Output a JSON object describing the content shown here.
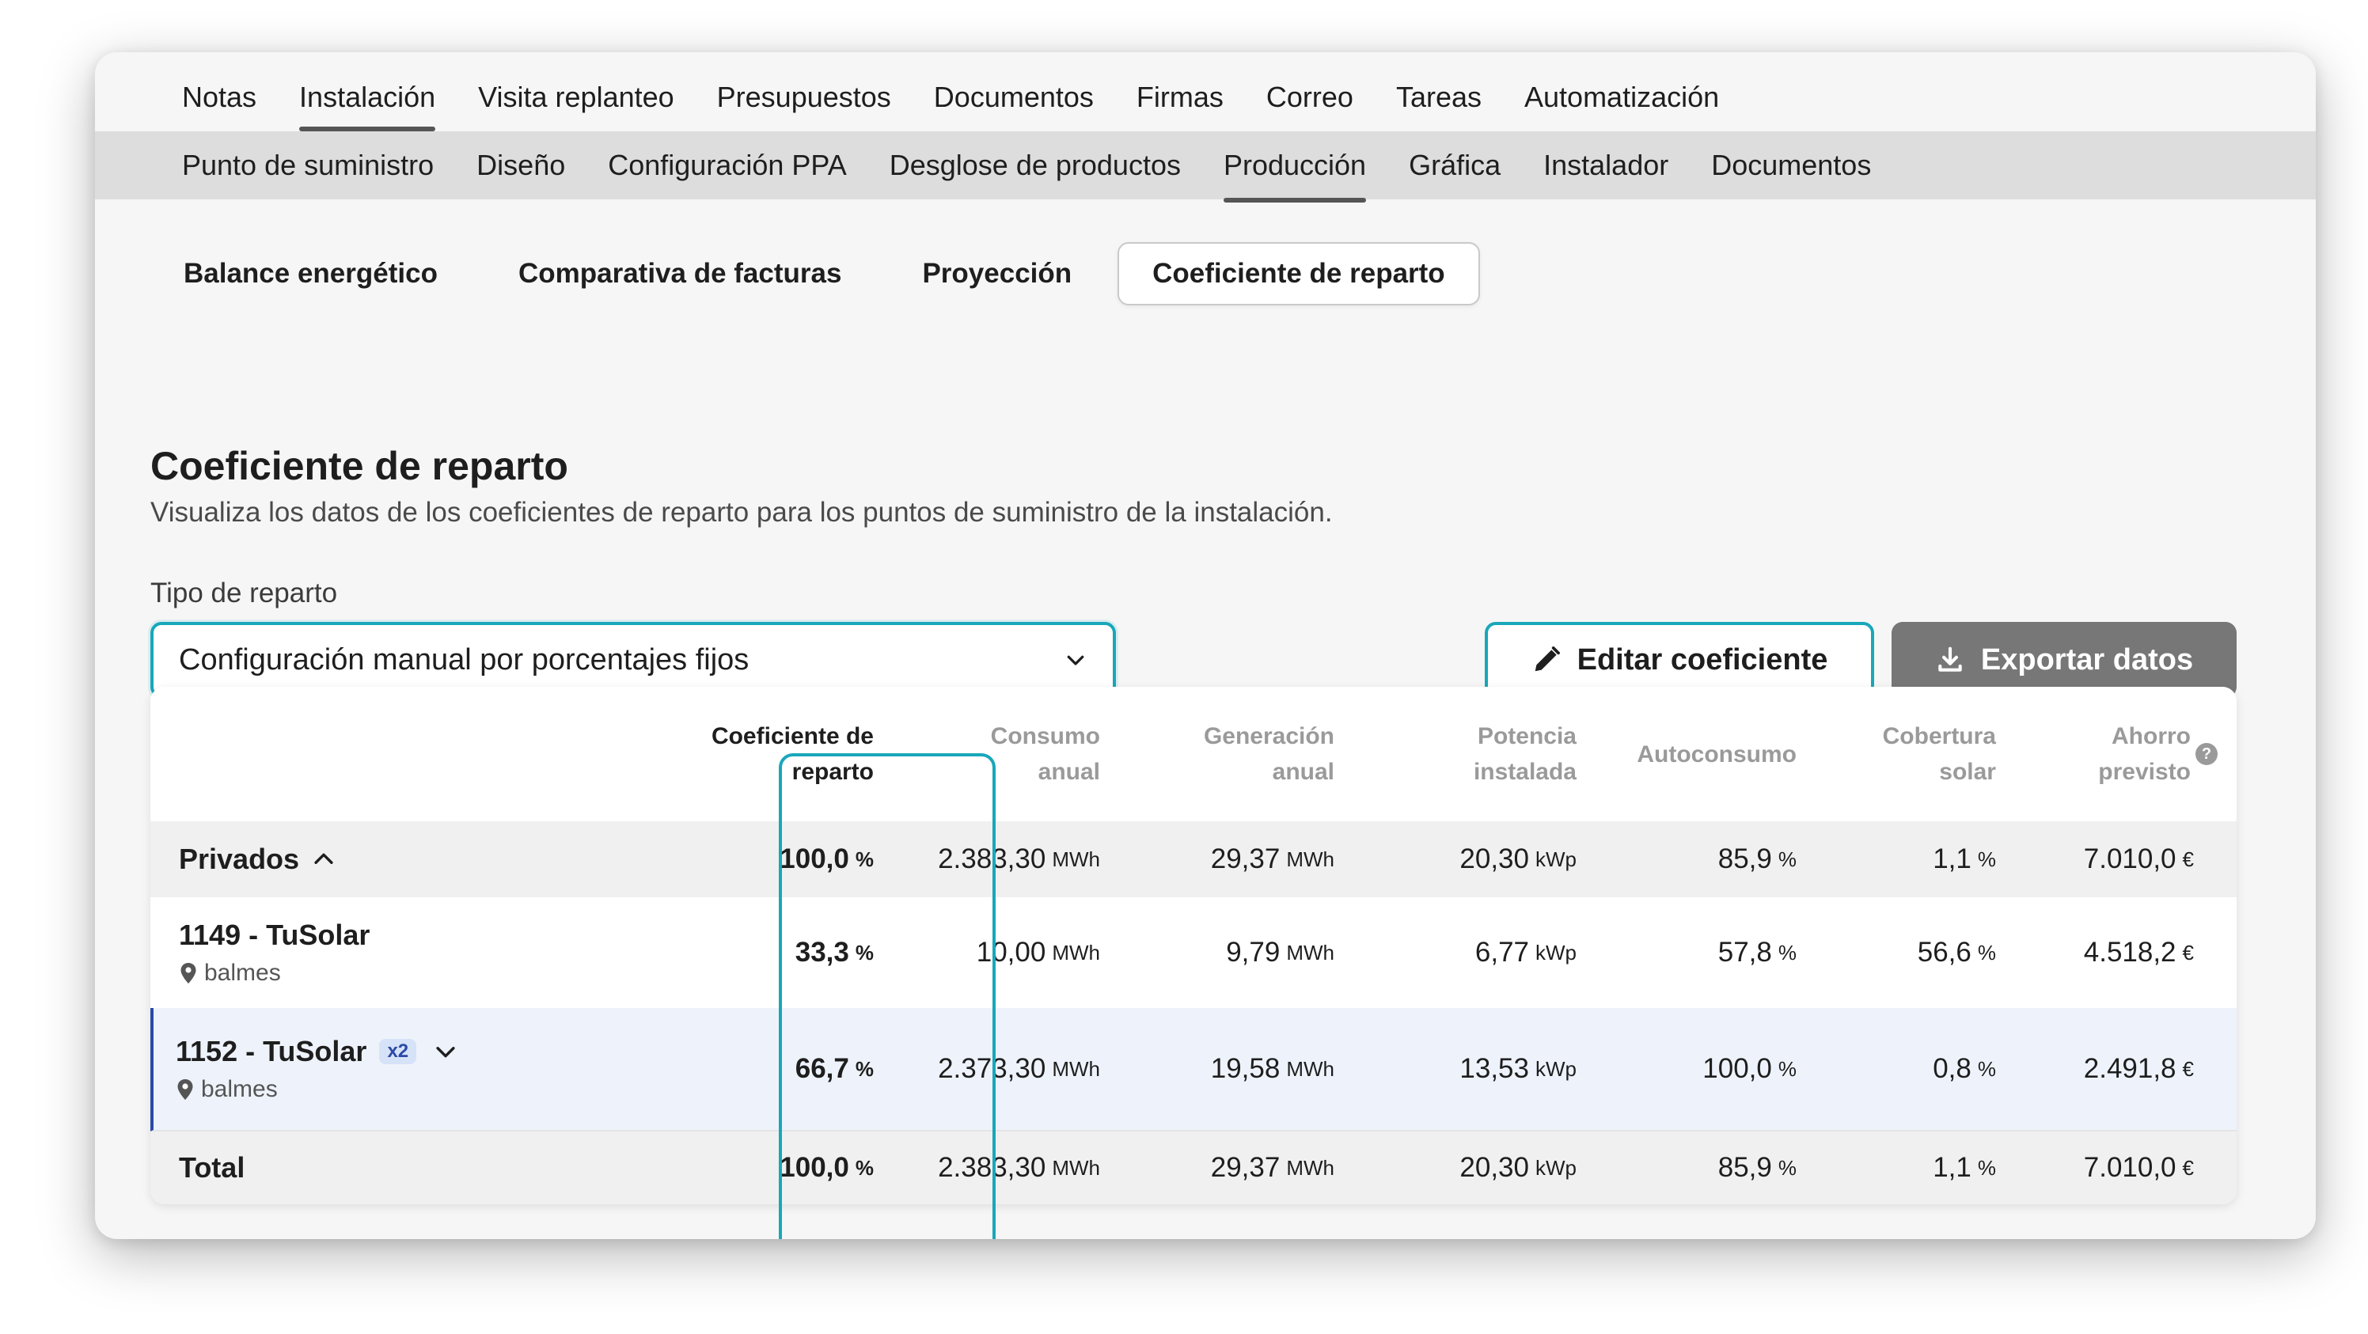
{
  "tabs_main": [
    "Notas",
    "Instalación",
    "Visita replanteo",
    "Presupuestos",
    "Documentos",
    "Firmas",
    "Correo",
    "Tareas",
    "Automatización"
  ],
  "tabs_sub": [
    "Punto de suministro",
    "Diseño",
    "Configuración PPA",
    "Desglose de productos",
    "Producción",
    "Gráfica",
    "Instalador",
    "Documentos"
  ],
  "pills": [
    "Balance energético",
    "Comparativa de facturas",
    "Proyección",
    "Coeficiente de reparto"
  ],
  "section": {
    "title": "Coeficiente de reparto",
    "description": "Visualiza los datos de los coeficientes de reparto para los puntos de suministro de la instalación."
  },
  "form": {
    "label": "Tipo de reparto",
    "selected": "Configuración manual por porcentajes fijos",
    "edit_button": "Editar coeficiente",
    "export_button": "Exportar datos"
  },
  "table": {
    "headers": {
      "coef_1": "Coeficiente de",
      "coef_2": "reparto",
      "consumo_1": "Consumo",
      "consumo_2": "anual",
      "generacion_1": "Generación",
      "generacion_2": "anual",
      "potencia_1": "Potencia",
      "potencia_2": "instalada",
      "autoconsumo": "Autoconsumo",
      "cobertura_1": "Cobertura",
      "cobertura_2": "solar",
      "ahorro_1": "Ahorro",
      "ahorro_2": "previsto",
      "help": "?"
    },
    "units": {
      "pct": "%",
      "mwh": "MWh",
      "kwp": "kWp",
      "eur": "€"
    },
    "group": {
      "label": "Privados",
      "coef": "100,0",
      "consumo": "2.383,30",
      "generacion": "29,37",
      "potencia": "20,30",
      "autoconsumo": "85,9",
      "cobertura": "1,1",
      "ahorro": "7.010,0"
    },
    "rows": [
      {
        "name": "1149 - TuSolar",
        "address": "balmes",
        "badge": "",
        "coef": "33,3",
        "consumo": "10,00",
        "generacion": "9,79",
        "potencia": "6,77",
        "autoconsumo": "57,8",
        "cobertura": "56,6",
        "ahorro": "4.518,2"
      },
      {
        "name": "1152 - TuSolar",
        "address": "balmes",
        "badge": "x2",
        "coef": "66,7",
        "consumo": "2.373,30",
        "generacion": "19,58",
        "potencia": "13,53",
        "autoconsumo": "100,0",
        "cobertura": "0,8",
        "ahorro": "2.491,8"
      }
    ],
    "total": {
      "label": "Total",
      "coef": "100,0",
      "consumo": "2.383,30",
      "generacion": "29,37",
      "potencia": "20,30",
      "autoconsumo": "85,9",
      "cobertura": "1,1",
      "ahorro": "7.010,0"
    }
  },
  "colors": {
    "accent": "#19a7ba",
    "selected_row_border": "#2a4aa8",
    "export_bg": "#777777"
  },
  "icons": [
    "chevron-down-icon",
    "pencil-icon",
    "download-icon",
    "chevron-up-icon",
    "map-pin-icon",
    "help-icon"
  ]
}
